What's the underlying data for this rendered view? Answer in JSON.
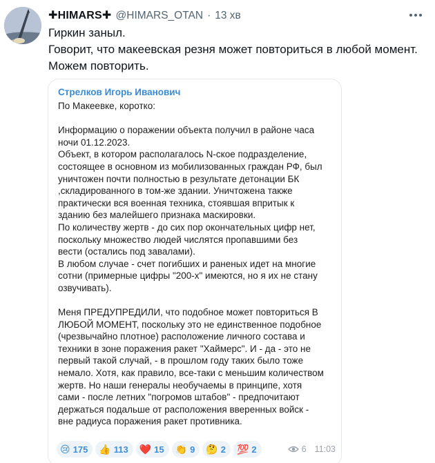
{
  "author": {
    "display_name": "✚HIMARS✚",
    "handle": "@HIMARS_OTAN",
    "separator": "·",
    "time": "13 хв"
  },
  "tweet_lines": [
    "Гиркин заныл.",
    "Говорит, что макеевская резня может повториться в любой момент.",
    "Можем повторить."
  ],
  "card": {
    "author": "Стрелков Игорь Иванович",
    "lines": [
      "По Макеевке, коротко:",
      "",
      "Информацию о поражении объекта получил в районе часа",
      "ночи 01.12.2023.",
      "Объект, в котором располагалось N-ское подразделение,",
      "состоящее в основном из мобилизованных граждан РФ, был",
      "уничтожен почти полностью в результате детонации БК",
      ",складированного в том-же здании. Уничтожена также",
      "практически вся военная техника, стоявшая впритык к",
      "зданию без малейшего признака маскировки.",
      "По количеству жертв - до сих пор окончательных цифр нет,",
      "поскольку множество людей числятся пропавшими без",
      "вести (остались под завалами).",
      "В любом случае - счет погибших и раненых идет на многие",
      "сотни (примерные цифры \"200-х\" имеются, но я их не стану",
      "озвучивать).",
      "",
      "Меня ПРЕДУПРЕДИЛИ, что подобное может повториться В",
      "ЛЮБОЙ МОМЕНТ, поскольку это не единственное подобное",
      "(чрезвычайно плотное) расположение личного состава и",
      "техники в зоне поражения ракет \"Хаймерс\". И - да - это не",
      "первый такой случай, - в прошлом году таких было тоже",
      "немало. Хотя, как правило, все-таки с меньшим количеством",
      "жертв. Но наши генералы необучаемы в принципе, хотя",
      "сами - после летних \"погромов штабов\" - предпочитают",
      "держаться подальше от расположения вверенных войск -",
      "вне радиуса поражения ракет противника."
    ],
    "reactions": [
      {
        "emoji": "😢",
        "count": "175"
      },
      {
        "emoji": "👍",
        "count": "113"
      },
      {
        "emoji": "❤️",
        "count": "15"
      },
      {
        "emoji": "👏",
        "count": "9"
      },
      {
        "emoji": "🤔",
        "count": "2"
      },
      {
        "emoji": "💯",
        "count": "2"
      }
    ],
    "views": "6",
    "time": "11:03"
  }
}
